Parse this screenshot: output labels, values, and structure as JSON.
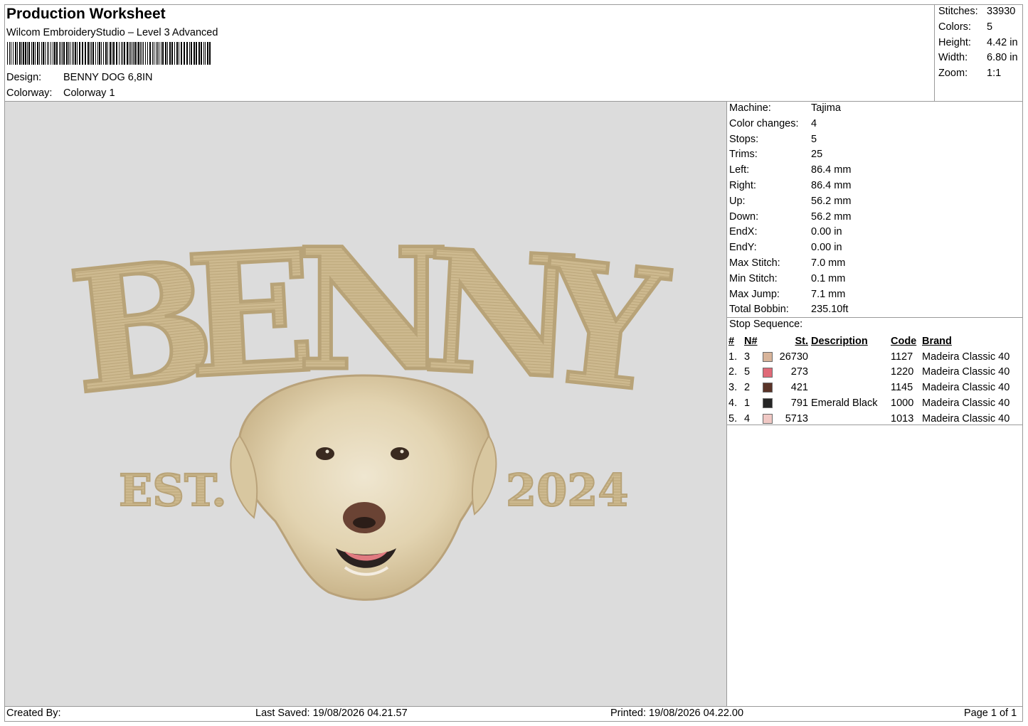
{
  "header": {
    "title": "Production Worksheet",
    "software": "Wilcom EmbroideryStudio – Level 3 Advanced",
    "design_label": "Design:",
    "design_value": "BENNY DOG 6,8IN",
    "colorway_label": "Colorway:",
    "colorway_value": "Colorway 1"
  },
  "summary": [
    {
      "label": "Stitches:",
      "value": "33930"
    },
    {
      "label": "Colors:",
      "value": "5"
    },
    {
      "label": "Height:",
      "value": "4.42 in"
    },
    {
      "label": "Width:",
      "value": "6.80 in"
    },
    {
      "label": "Zoom:",
      "value": "1:1"
    }
  ],
  "machine_info": [
    {
      "label": "Machine:",
      "value": "Tajima"
    },
    {
      "label": "Color changes:",
      "value": "4"
    },
    {
      "label": "Stops:",
      "value": "5"
    },
    {
      "label": "Trims:",
      "value": "25"
    },
    {
      "label": "Left:",
      "value": "86.4 mm"
    },
    {
      "label": "Right:",
      "value": "86.4 mm"
    },
    {
      "label": "Up:",
      "value": "56.2 mm"
    },
    {
      "label": "Down:",
      "value": "56.2 mm"
    },
    {
      "label": "EndX:",
      "value": "0.00 in"
    },
    {
      "label": "EndY:",
      "value": "0.00 in"
    },
    {
      "label": "Max Stitch:",
      "value": "7.0 mm"
    },
    {
      "label": "Min Stitch:",
      "value": "0.1 mm"
    },
    {
      "label": "Max Jump:",
      "value": "7.1 mm"
    },
    {
      "label": "Total Bobbin:",
      "value": "235.10ft"
    }
  ],
  "stop_sequence": {
    "title": "Stop Sequence:",
    "columns": [
      "#",
      "N#",
      "St.",
      "Description",
      "Code",
      "Brand"
    ],
    "rows": [
      {
        "idx": "1.",
        "n": "3",
        "color": "#d8b49a",
        "st": "26730",
        "desc": "",
        "code": "1127",
        "brand": "Madeira Classic 40"
      },
      {
        "idx": "2.",
        "n": "5",
        "color": "#e06a78",
        "st": "273",
        "desc": "",
        "code": "1220",
        "brand": "Madeira Classic 40"
      },
      {
        "idx": "3.",
        "n": "2",
        "color": "#5a3428",
        "st": "421",
        "desc": "",
        "code": "1145",
        "brand": "Madeira Classic 40"
      },
      {
        "idx": "4.",
        "n": "1",
        "color": "#262626",
        "st": "791",
        "desc": "Emerald Black",
        "code": "1000",
        "brand": "Madeira Classic 40"
      },
      {
        "idx": "5.",
        "n": "4",
        "color": "#f0c8c4",
        "st": "5713",
        "desc": "",
        "code": "1013",
        "brand": "Madeira Classic 40"
      }
    ]
  },
  "design_preview": {
    "name_text": "BENNY",
    "left_text": "EST.",
    "right_text": "2024",
    "thread_color": "#cbb68c",
    "background_color": "#dcdcdc"
  },
  "footer": {
    "created_by": "Created By:",
    "last_saved": "Last Saved: 19/08/2026 04.21.57",
    "printed": "Printed: 19/08/2026 04.22.00",
    "page": "Page 1 of 1"
  }
}
